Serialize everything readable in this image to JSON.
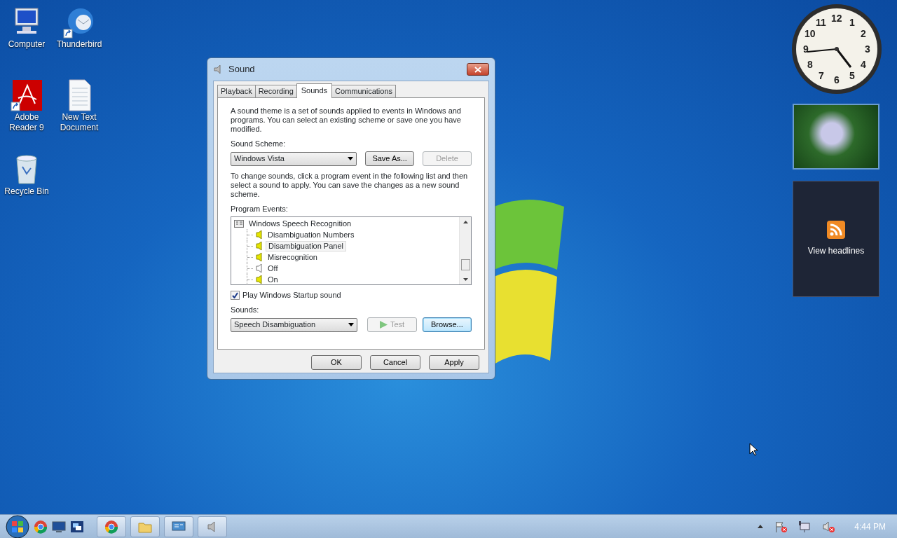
{
  "desktop_icons": [
    {
      "label": "Computer",
      "kind": "computer",
      "shortcut": false
    },
    {
      "label": "Thunderbird",
      "kind": "mail",
      "shortcut": true
    },
    {
      "label": "Adobe Reader 9",
      "kind": "pdf",
      "shortcut": true
    },
    {
      "label": "New Text Document",
      "kind": "text",
      "shortcut": false
    },
    {
      "label": "Recycle Bin",
      "kind": "bin",
      "shortcut": false
    }
  ],
  "window": {
    "title": "Sound",
    "tabs": [
      {
        "label": "Playback",
        "selected": false
      },
      {
        "label": "Recording",
        "selected": false
      },
      {
        "label": "Sounds",
        "selected": true
      },
      {
        "label": "Communications",
        "selected": false
      }
    ],
    "description": "A sound theme is a set of sounds applied to events in Windows and programs.  You can select an existing scheme or save one you have modified.",
    "scheme_label": "Sound Scheme:",
    "scheme": {
      "value": "Windows Vista"
    },
    "scheme_buttons": [
      {
        "label": "Save As...",
        "disabled": false
      },
      {
        "label": "Delete",
        "disabled": true
      }
    ],
    "instructions": "To change sounds, click a program event in the following list and then select a sound to apply.  You can save the changes as a new sound scheme.",
    "events_label": "Program Events:",
    "events": [
      {
        "label": "Windows Speech Recognition",
        "children": [
          {
            "label": "Disambiguation Numbers",
            "has_sound": true,
            "selected": false
          },
          {
            "label": "Disambiguation Panel",
            "has_sound": true,
            "selected": true
          },
          {
            "label": "Misrecognition",
            "has_sound": true,
            "selected": false
          },
          {
            "label": "Off",
            "has_sound": false,
            "selected": false
          },
          {
            "label": "On",
            "has_sound": true,
            "selected": false
          }
        ]
      }
    ],
    "startup_sound": {
      "label": "Play Windows Startup sound",
      "checked": true
    },
    "sounds_label": "Sounds:",
    "sound": {
      "value": "Speech Disambiguation"
    },
    "test_button": {
      "label": "Test",
      "disabled": true
    },
    "browse_button": {
      "label": "Browse...",
      "focused": true
    },
    "footer_buttons": [
      {
        "label": "OK"
      },
      {
        "label": "Cancel"
      },
      {
        "label": "Apply"
      }
    ]
  },
  "gadgets": {
    "clock_numbers": [
      "12",
      "11",
      "1",
      "10",
      "2",
      "9",
      "3",
      "8",
      "4",
      "7",
      "5",
      "6"
    ],
    "feed_label": "View headlines"
  },
  "taskbar": {
    "pinned": [
      {
        "kind": "browser"
      },
      {
        "kind": "monitor"
      },
      {
        "kind": "windows"
      }
    ],
    "buttons": [
      {
        "kind": "browser"
      },
      {
        "kind": "folder"
      },
      {
        "kind": "panel"
      },
      {
        "kind": "speaker"
      }
    ],
    "time": "4:44 PM"
  }
}
